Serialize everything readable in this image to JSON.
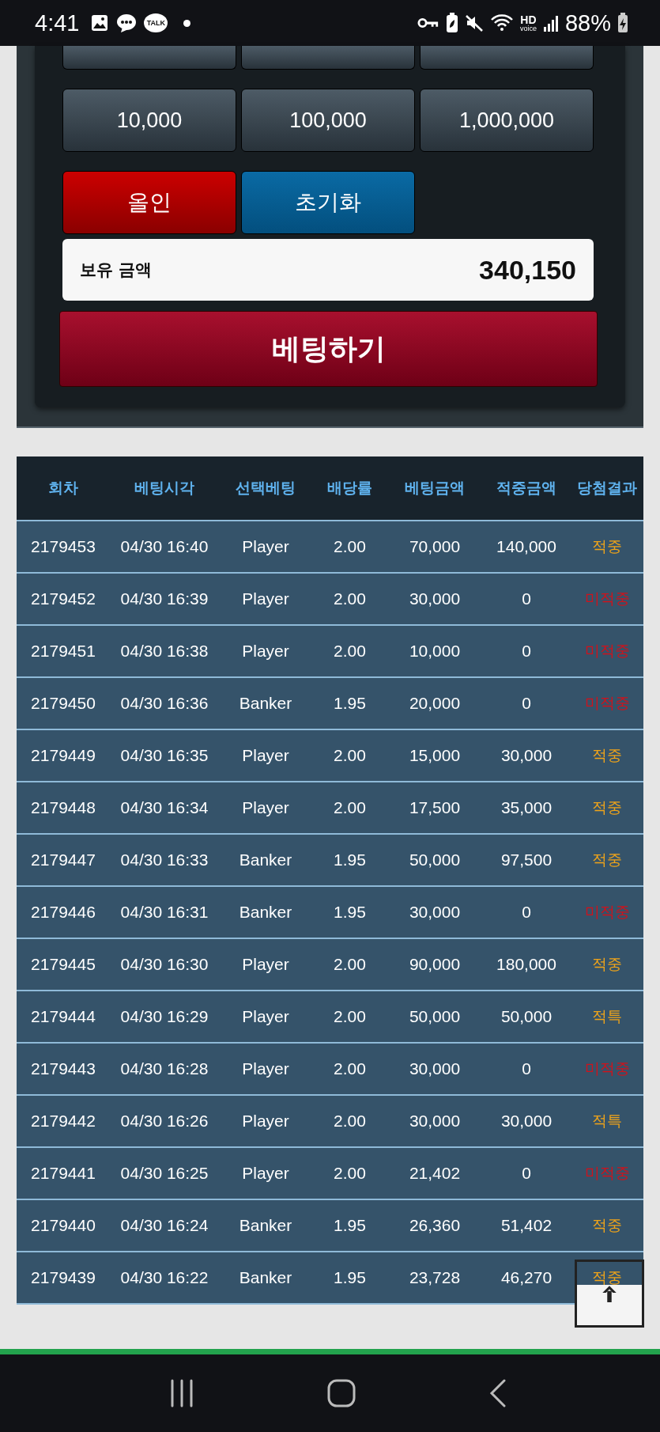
{
  "status_bar": {
    "time": "4:41",
    "talk_badge": "TALK",
    "hd_label": "HD",
    "voice_label": "voice",
    "battery": "88%"
  },
  "amount_buttons": [
    {
      "label": "10,000"
    },
    {
      "label": "100,000"
    },
    {
      "label": "1,000,000"
    }
  ],
  "action_buttons": [
    {
      "label": "올인",
      "kind": "allin"
    },
    {
      "label": "초기화",
      "kind": "reset"
    }
  ],
  "balance": {
    "label": "보유 금액",
    "value": "340,150"
  },
  "bet_button": "베팅하기",
  "table": {
    "columns": [
      "회차",
      "베팅시각",
      "선택베팅",
      "배당률",
      "베팅금액",
      "적중금액",
      "당첨결과"
    ],
    "rows": [
      {
        "cells": [
          "2179453",
          "04/30 16:40",
          "Player",
          "2.00",
          "70,000",
          "140,000",
          "적중"
        ],
        "color": "#f0a419"
      },
      {
        "cells": [
          "2179452",
          "04/30 16:39",
          "Player",
          "2.00",
          "30,000",
          "0",
          "미적중"
        ],
        "color": "#d0121b"
      },
      {
        "cells": [
          "2179451",
          "04/30 16:38",
          "Player",
          "2.00",
          "10,000",
          "0",
          "미적중"
        ],
        "color": "#d0121b"
      },
      {
        "cells": [
          "2179450",
          "04/30 16:36",
          "Banker",
          "1.95",
          "20,000",
          "0",
          "미적중"
        ],
        "color": "#d0121b"
      },
      {
        "cells": [
          "2179449",
          "04/30 16:35",
          "Player",
          "2.00",
          "15,000",
          "30,000",
          "적중"
        ],
        "color": "#f0a419"
      },
      {
        "cells": [
          "2179448",
          "04/30 16:34",
          "Player",
          "2.00",
          "17,500",
          "35,000",
          "적중"
        ],
        "color": "#f0a419"
      },
      {
        "cells": [
          "2179447",
          "04/30 16:33",
          "Banker",
          "1.95",
          "50,000",
          "97,500",
          "적중"
        ],
        "color": "#f0a419"
      },
      {
        "cells": [
          "2179446",
          "04/30 16:31",
          "Banker",
          "1.95",
          "30,000",
          "0",
          "미적중"
        ],
        "color": "#d0121b"
      },
      {
        "cells": [
          "2179445",
          "04/30 16:30",
          "Player",
          "2.00",
          "90,000",
          "180,000",
          "적중"
        ],
        "color": "#f0a419"
      },
      {
        "cells": [
          "2179444",
          "04/30 16:29",
          "Player",
          "2.00",
          "50,000",
          "50,000",
          "적특"
        ],
        "color": "#f0a419"
      },
      {
        "cells": [
          "2179443",
          "04/30 16:28",
          "Player",
          "2.00",
          "30,000",
          "0",
          "미적중"
        ],
        "color": "#d0121b"
      },
      {
        "cells": [
          "2179442",
          "04/30 16:26",
          "Player",
          "2.00",
          "30,000",
          "30,000",
          "적특"
        ],
        "color": "#f0a419"
      },
      {
        "cells": [
          "2179441",
          "04/30 16:25",
          "Player",
          "2.00",
          "21,402",
          "0",
          "미적중"
        ],
        "color": "#d0121b"
      },
      {
        "cells": [
          "2179440",
          "04/30 16:24",
          "Banker",
          "1.95",
          "26,360",
          "51,402",
          "적중"
        ],
        "color": "#f0a419"
      },
      {
        "cells": [
          "2179439",
          "04/30 16:22",
          "Banker",
          "1.95",
          "23,728",
          "46,270",
          "적중"
        ],
        "color": "#f0a419"
      }
    ]
  }
}
